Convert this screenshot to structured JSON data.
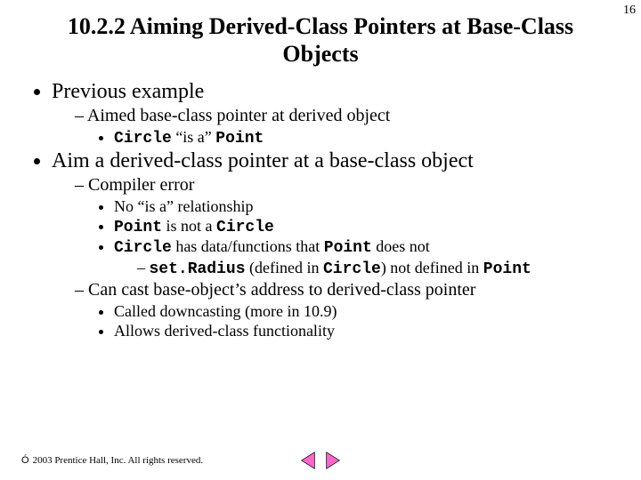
{
  "pageNumber": "16",
  "title": "10.2.2 Aiming Derived-Class Pointers at Base-Class Objects",
  "b1": {
    "t": "Previous example",
    "s1": {
      "t": "Aimed base-class pointer at derived object",
      "c1a": "Circle",
      "c1b": " “is a” ",
      "c1c": "Point"
    }
  },
  "b2": {
    "t": "Aim a derived-class pointer at a base-class object",
    "s1": {
      "t": "Compiler error",
      "c1": "No “is a” relationship",
      "c2a": "Point",
      "c2b": " is not a ",
      "c2c": "Circle",
      "c3a": "Circle",
      "c3b": " has data/functions that ",
      "c3c": "Point",
      "c3d": " does not",
      "d1a": "set.Radius",
      "d1b": " (defined in ",
      "d1c": "Circle",
      "d1d": ") not defined in ",
      "d1e": "Point"
    },
    "s2": {
      "t": "Can cast base-object’s address to derived-class pointer",
      "c1": "Called downcasting (more in 10.9)",
      "c2": "Allows derived-class functionality"
    }
  },
  "footer": {
    "copy": "Ó",
    "text": " 2003 Prentice Hall, Inc. All rights reserved."
  }
}
